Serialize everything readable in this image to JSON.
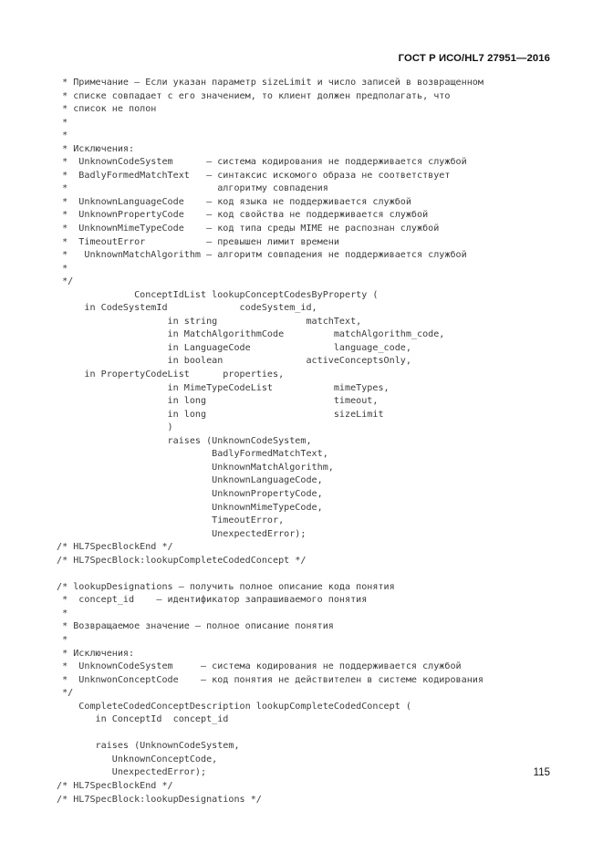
{
  "document": {
    "header_title": "ГОСТ Р ИСО/HL7 27951—2016",
    "page_number": "115"
  },
  "code": {
    "lines": [
      " * Примечание – Если указан параметр sizeLimit и число записей в возвращенном",
      " * списке совпадает с его значением, то клиент должен предполагать, что",
      " * список не полон",
      " *",
      " *",
      " * Исключения:",
      " *  UnknownCodeSystem      – система кодирования не поддерживается службой",
      " *  BadlyFormedMatchText   – синтаксис искомого образа не соответствует",
      " *                           алгоритму совпадения",
      " *  UnknownLanguageCode    – код языка не поддерживается службой",
      " *  UnknownPropertyCode    – код свойства не поддерживается службой",
      " *  UnknownMimeTypeCode    – код типа среды MIME не распознан службой",
      " *  TimeoutError           – превышен лимит времени",
      " *   UnknownMatchAlgorithm – алгоритм совпадения не поддерживается службой",
      " *",
      " */",
      "              ConceptIdList lookupConceptCodesByProperty (",
      "     in CodeSystemId             codeSystem_id,",
      "                    in string                matchText,",
      "                    in MatchAlgorithmCode         matchAlgorithm_code,",
      "                    in LanguageCode               language_code,",
      "                    in boolean               activeConceptsOnly,",
      "     in PropertyCodeList      properties,",
      "                    in MimeTypeCodeList           mimeTypes,",
      "                    in long                       timeout,",
      "                    in long                       sizeLimit",
      "                    )",
      "                    raises (UnknownCodeSystem,",
      "                            BadlyFormedMatchText,",
      "                            UnknownMatchAlgorithm,",
      "                            UnknownLanguageCode,",
      "                            UnknownPropertyCode,",
      "                            UnknownMimeTypeCode,",
      "                            TimeoutError,",
      "                            UnexpectedError);",
      "/* HL7SpecBlockEnd */",
      "/* HL7SpecBlock:lookupCompleteCodedConcept */",
      "",
      "/* lookupDesignations – получить полное описание кода понятия",
      " *  concept_id    – идентификатор запрашиваемого понятия",
      " *",
      " * Возвращаемое значение – полное описание понятия",
      " *",
      " * Исключения:",
      " *  UnknownCodeSystem     – система кодирования не поддерживается службой",
      " *  UnknwonConceptCode    – код понятия не действителен в системе кодирования",
      " */",
      "    CompleteCodedConceptDescription lookupCompleteCodedConcept (",
      "       in ConceptId  concept_id",
      "",
      "       raises (UnknownCodeSystem,",
      "          UnknownConceptCode,",
      "          UnexpectedError);",
      "/* HL7SpecBlockEnd */",
      "/* HL7SpecBlock:lookupDesignations */"
    ]
  }
}
